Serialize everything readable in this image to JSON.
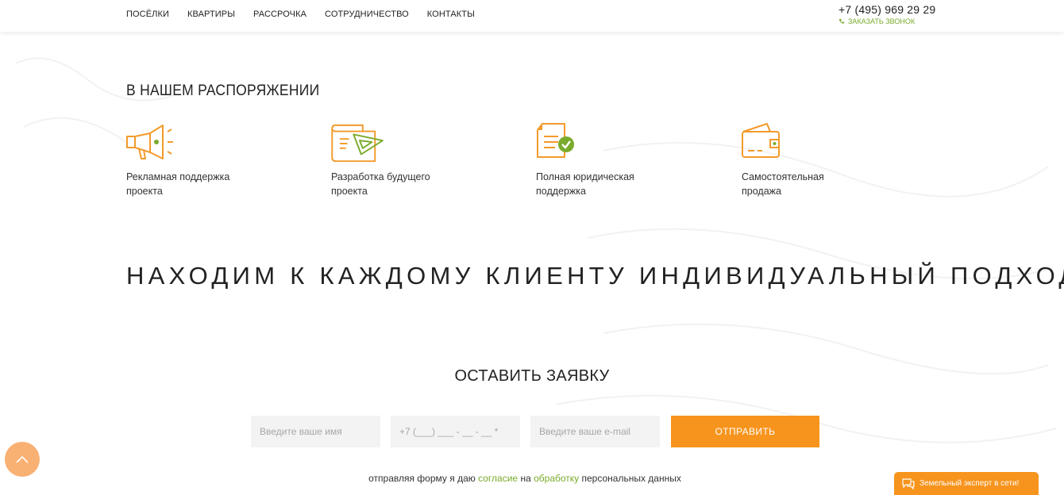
{
  "nav": {
    "items": [
      "ПОСЁЛКИ",
      "КВАРТИРЫ",
      "РАССРОЧКА",
      "СОТРУДНИЧЕСТВО",
      "КОНТАКТЫ"
    ]
  },
  "header": {
    "phone": "+7 (495) 969 29 29",
    "callback_label": "ЗАКАЗАТЬ ЗВОНОК"
  },
  "section": {
    "title": "В НАШЕМ РАСПОРЯЖЕНИИ",
    "features": [
      {
        "icon": "megaphone-icon",
        "label_line1": "Рекламная поддержка",
        "label_line2": "проекта"
      },
      {
        "icon": "blueprint-icon",
        "label_line1": "Разработка будущего",
        "label_line2": "проекта"
      },
      {
        "icon": "document-check-icon",
        "label_line1": "Полная юридическая",
        "label_line2": "поддержка"
      },
      {
        "icon": "wallet-icon",
        "label_line1": "Самостоятельная",
        "label_line2": "продажа"
      }
    ]
  },
  "headline": "НАХОДИМ К КАЖДОМУ КЛИЕНТУ ИНДИВИДУАЛЬНЫЙ ПОДХОД",
  "form": {
    "title": "ОСТАВИТЬ ЗАЯВКУ",
    "name_placeholder": "Введите ваше имя",
    "phone_placeholder": "+7 (___) ___ - __ - __ *",
    "email_placeholder": "Введите ваше e-mail",
    "submit_label": "ОТПРАВИТЬ"
  },
  "consent": {
    "prefix": "отправляя форму я даю",
    "link1": "согласие",
    "middle": "на",
    "link2": "обработку",
    "suffix": "персональных данных"
  },
  "chat": {
    "label": "Земельный эксперт в сети!"
  },
  "colors": {
    "accent_orange": "#f7941d",
    "accent_green": "#7aab2c",
    "icon_orange": "#f39a2b"
  }
}
